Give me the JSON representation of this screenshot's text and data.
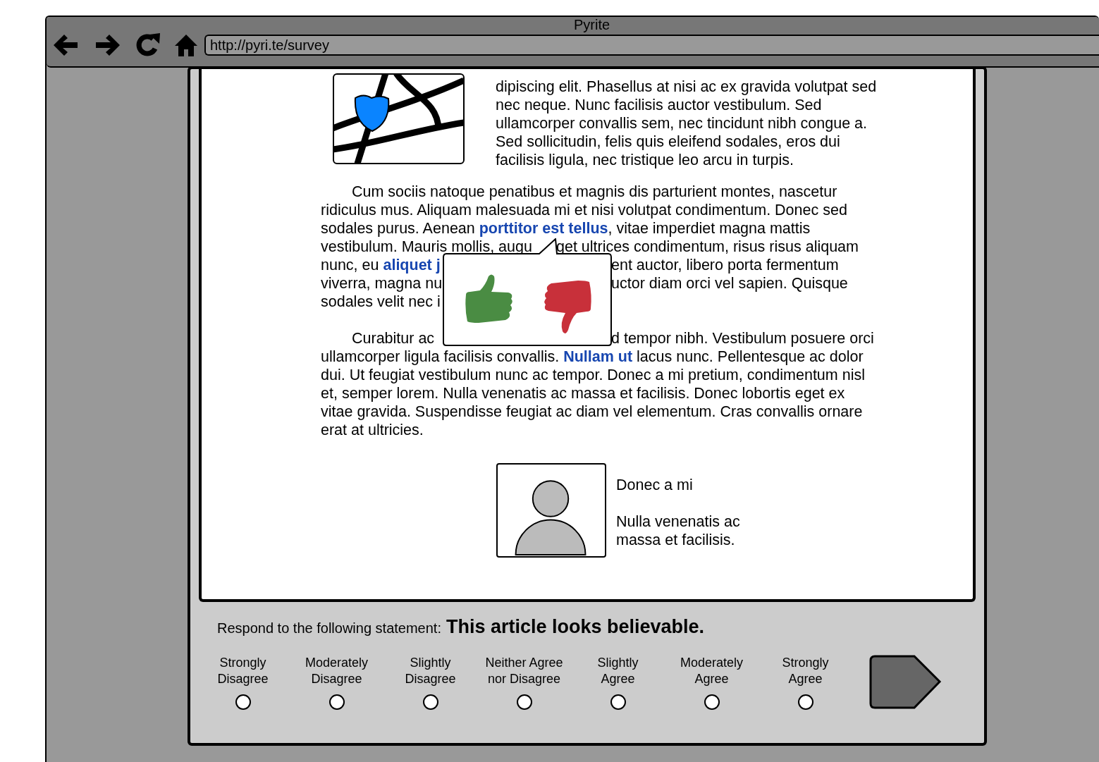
{
  "window": {
    "title": "Pyrite"
  },
  "toolbar": {
    "url": "http://pyri.te/survey"
  },
  "article": {
    "intro_lines": [
      "dipiscing elit. Phasellus at nisi ac ex gravida volutpat sed",
      "nec neque. Nunc facilisis auctor vestibulum. Sed",
      "ullamcorper convallis sem, nec tincidunt nibh congue a.",
      "Sed sollicitudin, felis quis eleifend sodales, eros dui",
      "facilisis ligula, nec tristique leo arcu in turpis."
    ],
    "paragraphs": [
      {
        "lines": [
          {
            "left": "Cum sociis natoque penatibus et magnis dis parturient montes, nascetur"
          },
          {
            "left": "ridiculus mus. Aliquam malesuada mi et nisi volutpat condimentum. Donec sed"
          },
          {
            "left": "sodales purus. Aenean **porttitor est tellus**, vitae imperdiet magna mattis"
          },
          {
            "left": "vestibulum. Mauris mollis, augu",
            "right": "get ultrices condimentum, risus risus aliquam"
          },
          {
            "left": "nunc, eu **aliquet j**",
            "right": "ent auctor, libero porta fermentum"
          },
          {
            "left": "viverra, magna nu",
            "right": "uctor diam orci vel sapien. Quisque"
          },
          {
            "left": "sodales velit nec i"
          }
        ]
      },
      {
        "lines": [
          {
            "left": "Curabitur ac",
            "right": "d tempor nibh. Vestibulum posuere orci"
          },
          {
            "left": "ullamcorper ligula facilisis convallis. **Nullam ut** lacus nunc. Pellentesque ac dolor"
          },
          {
            "left": "dui. Ut feugiat vestibulum nunc ac tempor. Donec a mi pretium, condimentum nisl"
          },
          {
            "left": "et, semper lorem. Nulla venenatis ac massa et facilisis. Donec lobortis eget ex"
          },
          {
            "left": "vitae gravida. Suspendisse feugiat ac diam vel elementum. Cras convallis ornare"
          },
          {
            "left": "erat at ultricies."
          }
        ]
      }
    ],
    "profile": {
      "name": "Donec a mi",
      "caption": "Nulla venenatis ac\nmassa et facilisis."
    }
  },
  "survey": {
    "prompt": "Respond to the following statement:",
    "statement": "This article looks believable.",
    "options": [
      {
        "label": "Strongly\nDisagree",
        "selected": false
      },
      {
        "label": "Moderately\nDisagree",
        "selected": false
      },
      {
        "label": "Slightly\nDisagree",
        "selected": false
      },
      {
        "label": "Neither Agree\nnor Disagree",
        "selected": false
      },
      {
        "label": "Slightly\nAgree",
        "selected": false
      },
      {
        "label": "Moderately\nAgree",
        "selected": false
      },
      {
        "label": "Strongly\nAgree",
        "selected": false
      }
    ]
  }
}
